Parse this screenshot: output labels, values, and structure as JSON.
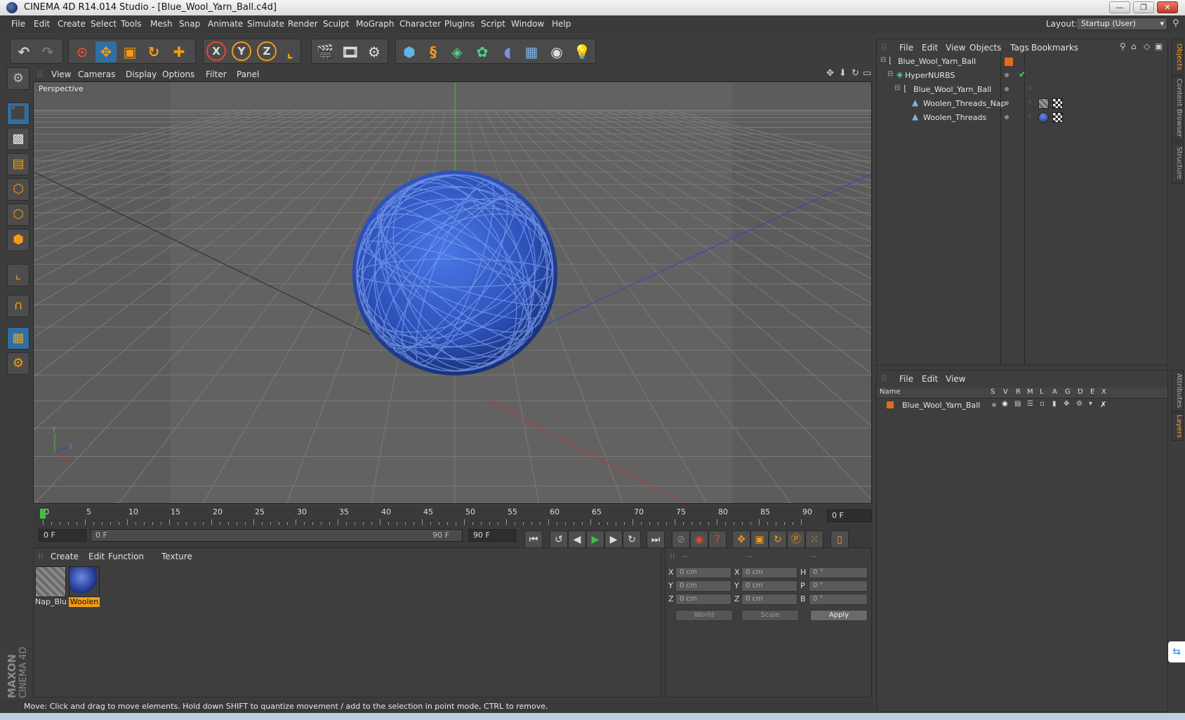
{
  "window": {
    "title": "CINEMA 4D R14.014 Studio - [Blue_Wool_Yarn_Ball.c4d]",
    "minimize_glyph": "—",
    "restore_glyph": "❐",
    "close_glyph": "✕"
  },
  "menubar": {
    "items": [
      "File",
      "Edit",
      "Create",
      "Select",
      "Tools",
      "Mesh",
      "Snap",
      "Animate",
      "Simulate",
      "Render",
      "Sculpt",
      "MoGraph",
      "Character",
      "Plugins",
      "Script",
      "Window",
      "Help"
    ],
    "layout_label": "Layout:",
    "layout_value": "Startup (User)"
  },
  "toolbar": {
    "icons": [
      "undo-icon",
      "redo-icon",
      "select-cursor-icon",
      "move-icon",
      "scale-icon",
      "rotate-icon",
      "add-icon",
      "x-axis-icon",
      "y-axis-icon",
      "z-axis-icon",
      "coordinate-system-icon",
      "render-view-icon",
      "render-picture-viewer-icon",
      "render-settings-icon",
      "cube-icon",
      "spline-pen-icon",
      "nurbs-icon",
      "array-icon",
      "deformer-icon",
      "floor-icon",
      "camera-icon",
      "light-icon"
    ],
    "axis_labels": [
      "X",
      "Y",
      "Z"
    ]
  },
  "viewport": {
    "menu": [
      "View",
      "Cameras",
      "Display",
      "Options",
      "Filter",
      "Panel"
    ],
    "label": "Perspective",
    "axis_y": "Y",
    "axis_z": "Z",
    "axis_x": "X"
  },
  "timeline": {
    "ticks": [
      "0",
      "5",
      "10",
      "15",
      "20",
      "25",
      "30",
      "35",
      "40",
      "45",
      "50",
      "55",
      "60",
      "65",
      "70",
      "75",
      "80",
      "85",
      "90"
    ],
    "current_frame": "0 F",
    "start_field": "0 F",
    "range_start": "0 F",
    "range_end": "90 F",
    "end_field": "90 F"
  },
  "material_manager": {
    "menu": [
      "Create",
      "Edit",
      "Function",
      "Texture"
    ],
    "materials": [
      {
        "label": "Nap_Blu",
        "selected": false
      },
      {
        "label": "Woolen",
        "selected": true
      }
    ]
  },
  "coordinates": {
    "header": [
      "--",
      "--",
      "--"
    ],
    "rows": [
      {
        "l1": "X",
        "v1": "0 cm",
        "l2": "X",
        "v2": "0 cm",
        "l3": "H",
        "v3": "0 °"
      },
      {
        "l1": "Y",
        "v1": "0 cm",
        "l2": "Y",
        "v2": "0 cm",
        "l3": "P",
        "v3": "0 °"
      },
      {
        "l1": "Z",
        "v1": "0 cm",
        "l2": "Z",
        "v2": "0 cm",
        "l3": "B",
        "v3": "0 °"
      }
    ],
    "world": "World",
    "scale": "Scale",
    "apply": "Apply"
  },
  "status": {
    "text": "Move: Click and drag to move elements. Hold down SHIFT to quantize movement / add to the selection in point mode, CTRL to remove."
  },
  "object_manager": {
    "menu": [
      "File",
      "Edit",
      "View",
      "Objects",
      "Tags",
      "Bookmarks"
    ],
    "objects": [
      {
        "name": "Blue_Wool_Yarn_Ball"
      },
      {
        "name": "HyperNURBS"
      },
      {
        "name": "Blue_Wool_Yarn_Ball"
      },
      {
        "name": "Woolen_Threads_Nap"
      },
      {
        "name": "Woolen_Threads"
      }
    ]
  },
  "layer_manager": {
    "menu": [
      "File",
      "Edit",
      "View"
    ],
    "columns": [
      "Name",
      "S",
      "V",
      "R",
      "M",
      "L",
      "A",
      "G",
      "D",
      "E",
      "X"
    ],
    "layers": [
      {
        "name": "Blue_Wool_Yarn_Ball"
      }
    ]
  },
  "right_tabs": [
    "Objects",
    "Content Browser",
    "Structure",
    "Attributes",
    "Layers"
  ],
  "brand": {
    "line1": "MAXON",
    "line2": "CINEMA 4D"
  },
  "colors": {
    "accent_blue": "#2f6fa3",
    "layer_orange": "#e5691d",
    "yarn_blue": "#2e55c0"
  }
}
